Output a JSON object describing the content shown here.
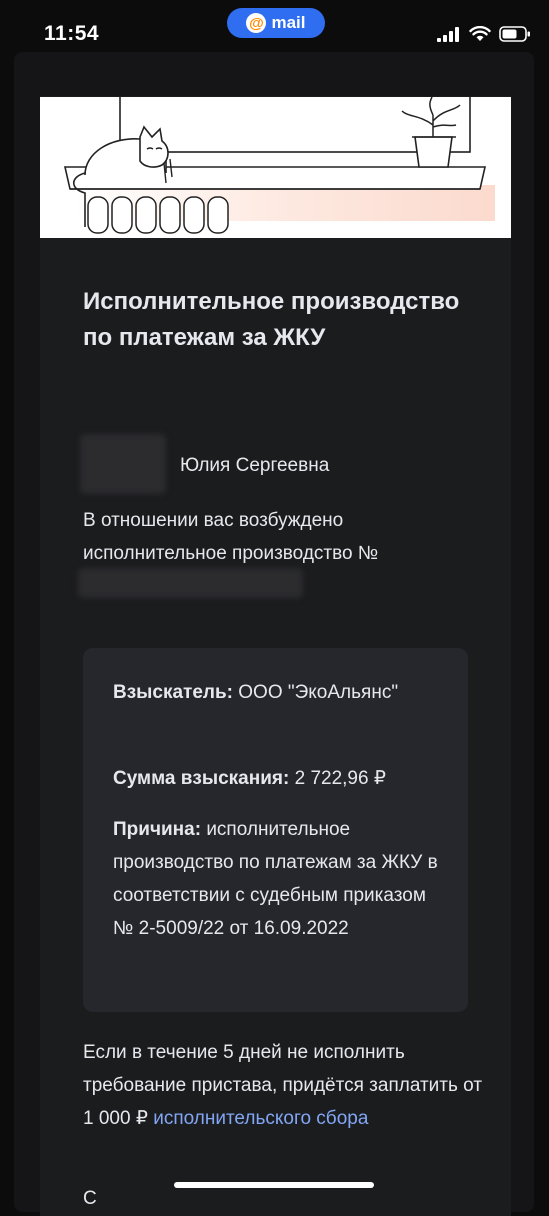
{
  "status_bar": {
    "time": "11:54",
    "app_pill_label": "mail",
    "app_pill_icon": "at-icon"
  },
  "email": {
    "title": "Исполнительное производство по платежам за ЖКУ",
    "greeting_name": "Юлия Сергеевна",
    "intro": "В отношении вас возбуждено исполнительное производство №",
    "details": {
      "claimant_label": "Взыскатель:",
      "claimant_value": "ООО \"ЭкоАльянс\"",
      "amount_label": "Сумма взыскания:",
      "amount_value": "2 722,96 ₽",
      "reason_label": "Причина:",
      "reason_value": "исполнительное производство по платежам за ЖКУ в соответствии с судебным приказом № 2-5009/22 от 16.09.2022"
    },
    "warning_text": "Если в течение 5 дней не исполнить требование пристава, придётся заплатить от 1 000 ₽",
    "warning_link": "исполнительского сбора",
    "next_line_start": "С"
  },
  "colors": {
    "pill": "#2f6ef0",
    "link": "#82a6f5",
    "box": "#25272d"
  }
}
